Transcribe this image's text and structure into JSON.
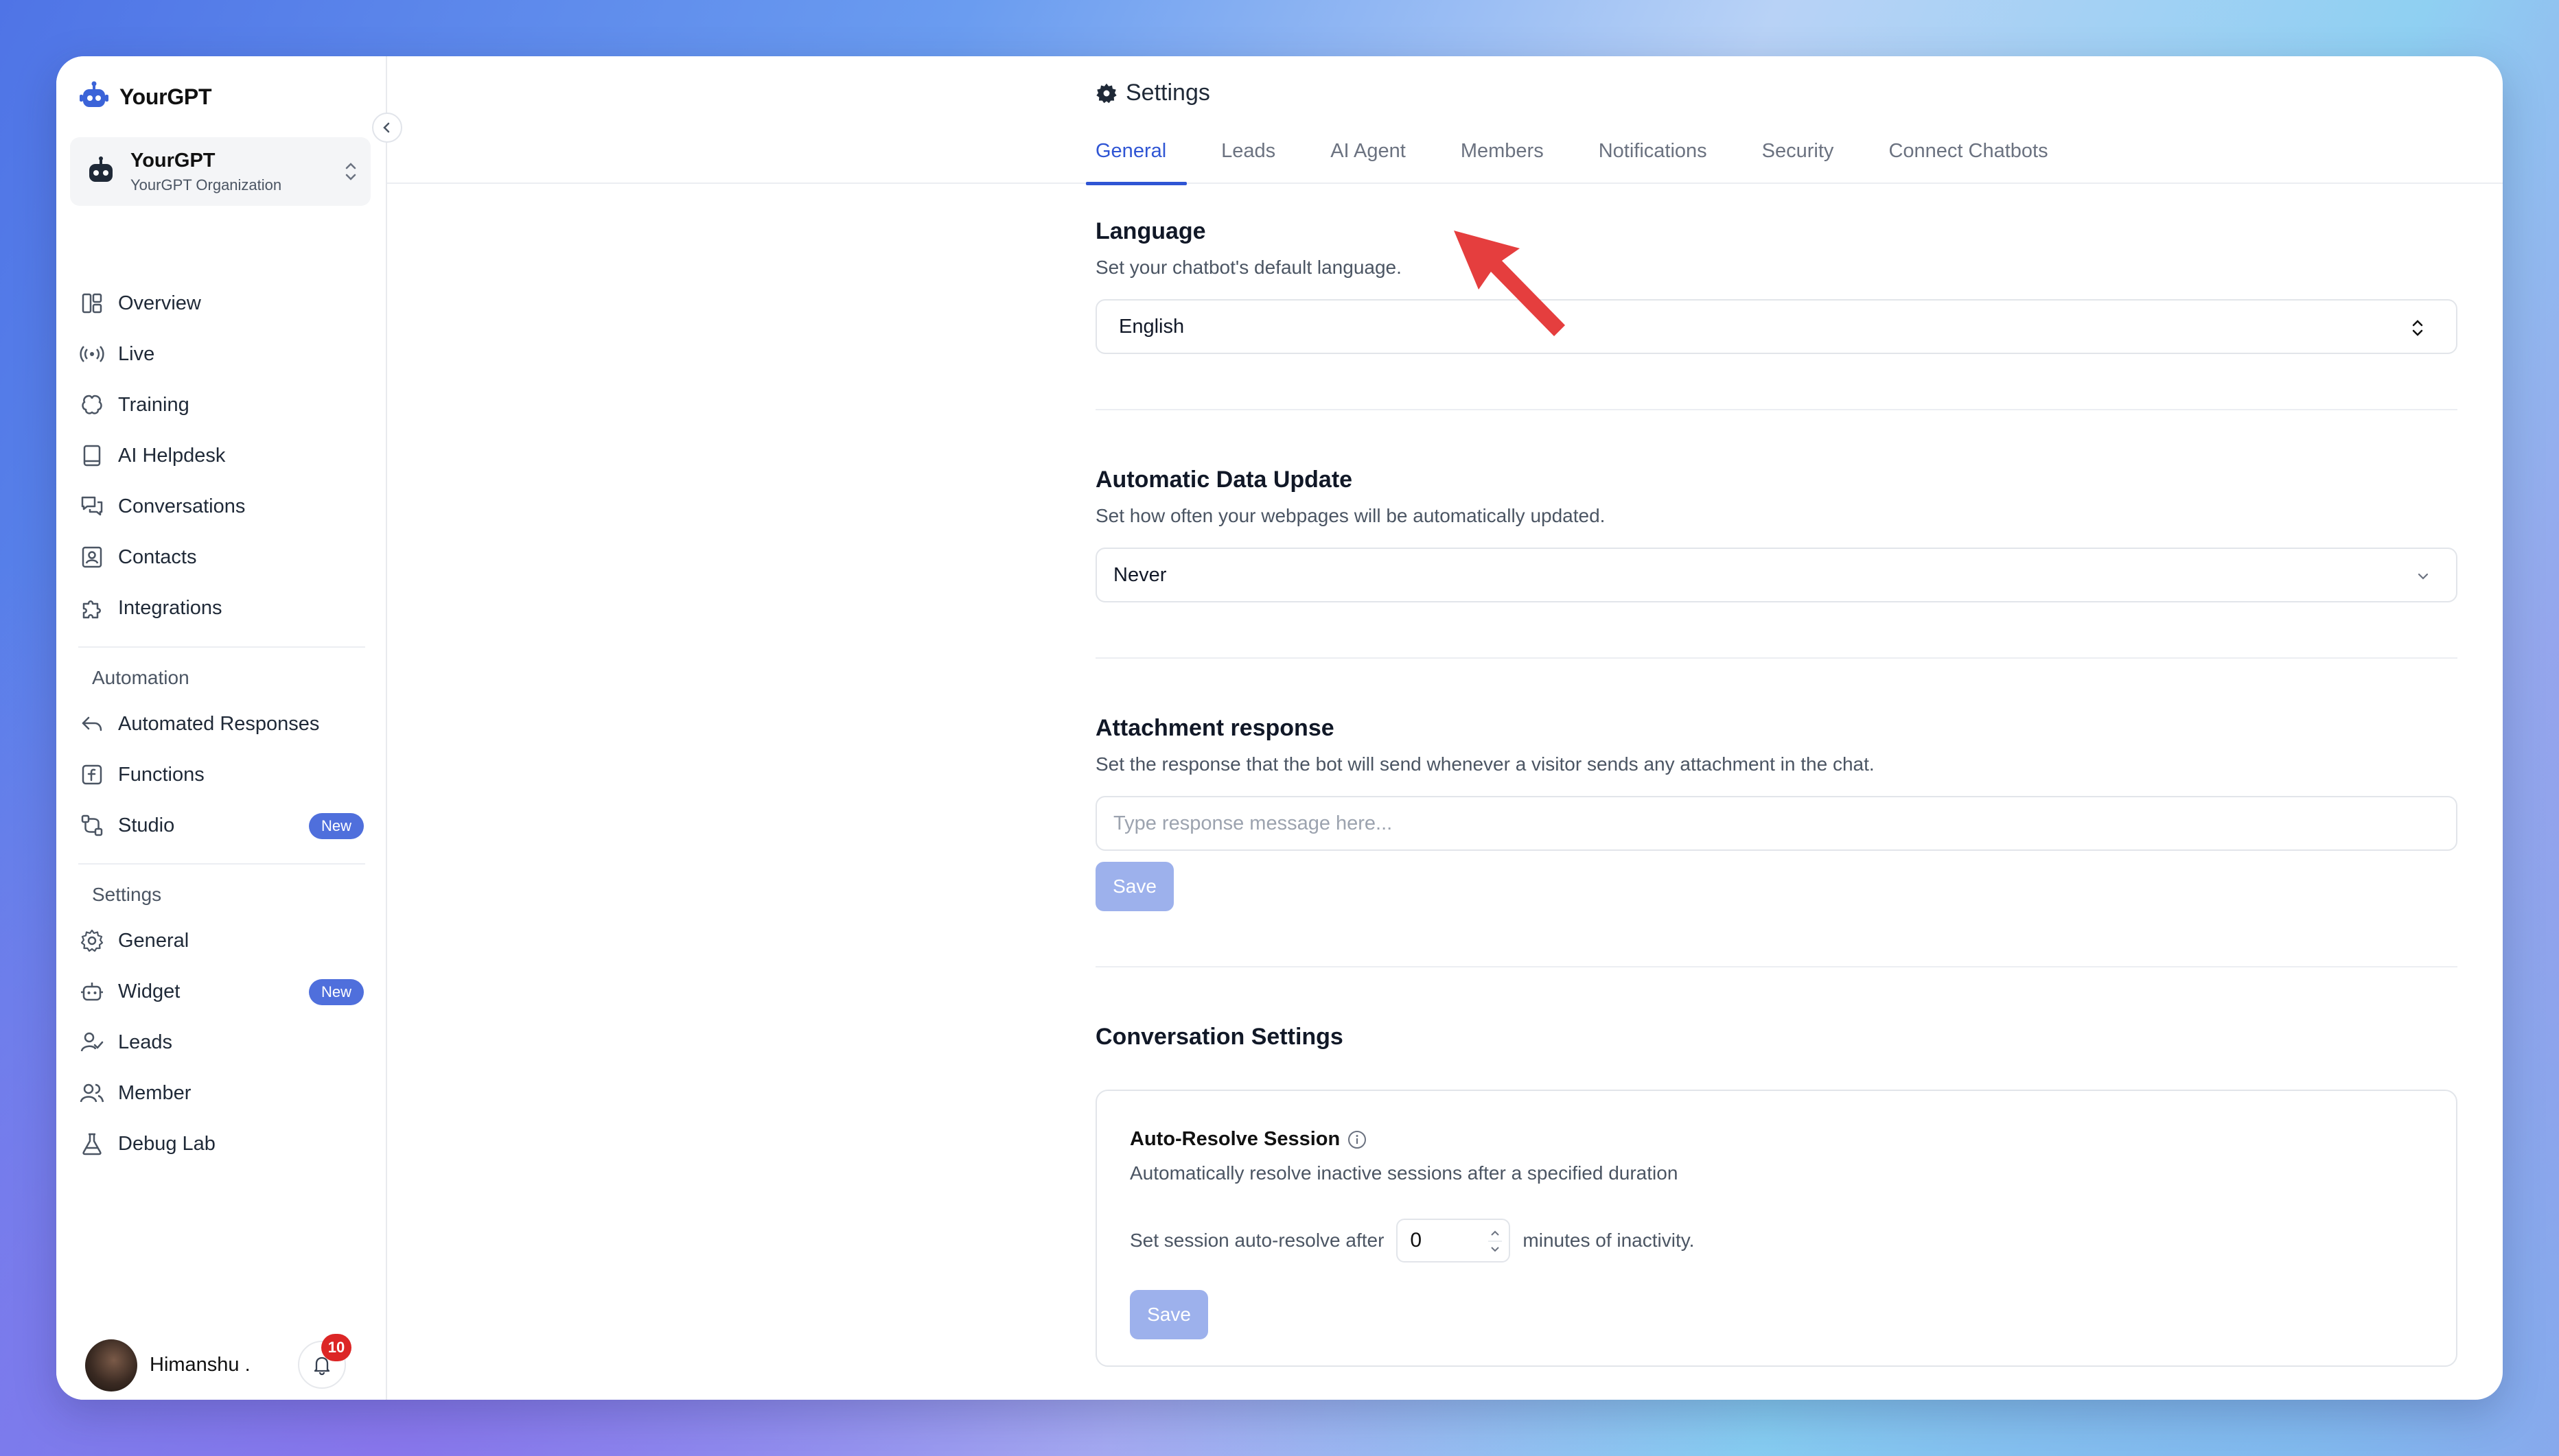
{
  "brand": {
    "name": "YourGPT"
  },
  "org": {
    "name": "YourGPT",
    "subtitle": "YourGPT Organization"
  },
  "sidebar": {
    "main_items": [
      {
        "label": "Overview",
        "icon": "layout-icon"
      },
      {
        "label": "Live",
        "icon": "broadcast-icon"
      },
      {
        "label": "Training",
        "icon": "brain-icon"
      },
      {
        "label": "AI Helpdesk",
        "icon": "book-icon"
      },
      {
        "label": "Conversations",
        "icon": "chat-bubbles-icon"
      },
      {
        "label": "Contacts",
        "icon": "contact-card-icon"
      },
      {
        "label": "Integrations",
        "icon": "puzzle-icon"
      }
    ],
    "automation_label": "Automation",
    "automation_items": [
      {
        "label": "Automated Responses",
        "icon": "reply-icon"
      },
      {
        "label": "Functions",
        "icon": "function-icon"
      },
      {
        "label": "Studio",
        "icon": "flow-icon",
        "badge": "New"
      }
    ],
    "settings_label": "Settings",
    "settings_items": [
      {
        "label": "General",
        "icon": "gear-icon"
      },
      {
        "label": "Widget",
        "icon": "bot-icon",
        "badge": "New"
      },
      {
        "label": "Leads",
        "icon": "user-check-icon"
      },
      {
        "label": "Member",
        "icon": "users-icon"
      },
      {
        "label": "Debug Lab",
        "icon": "flask-icon"
      }
    ],
    "user": {
      "name": "Himanshu .",
      "notifications": "10"
    }
  },
  "header": {
    "title": "Settings",
    "tabs": [
      "General",
      "Leads",
      "AI Agent",
      "Members",
      "Notifications",
      "Security",
      "Connect Chatbots"
    ],
    "active_tab": "General"
  },
  "language": {
    "title": "Language",
    "description": "Set your chatbot's default language.",
    "value": "English"
  },
  "data_update": {
    "title": "Automatic Data Update",
    "description": "Set how often your webpages will be automatically updated.",
    "value": "Never"
  },
  "attachment": {
    "title": "Attachment response",
    "description": "Set the response that the bot will send whenever a visitor sends any attachment in the chat.",
    "placeholder": "Type response message here...",
    "save_label": "Save"
  },
  "conversation": {
    "title": "Conversation Settings",
    "card_title": "Auto-Resolve Session",
    "card_description": "Automatically resolve inactive sessions after a specified duration",
    "prefix": "Set session auto-resolve after",
    "value": "0",
    "suffix": "minutes of inactivity.",
    "save_label": "Save"
  },
  "colors": {
    "accent": "#2f55d4",
    "badge": "#4f6fdc",
    "disabled_button": "#9db1ec",
    "notification": "#dc2626",
    "arrow": "#e53e3e"
  }
}
